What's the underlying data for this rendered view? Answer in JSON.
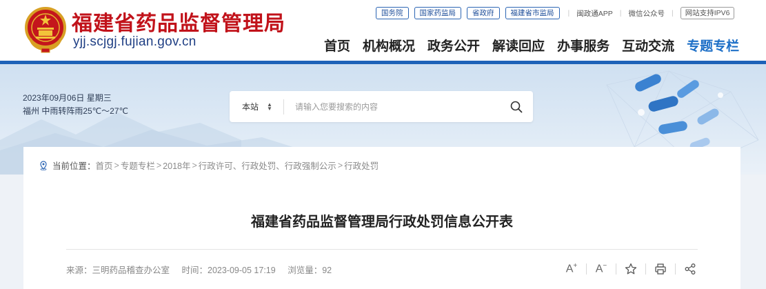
{
  "header": {
    "site_name": "福建省药品监督管理局",
    "site_domain": "yjj.scjgj.fujian.gov.cn",
    "top_links": [
      "国务院",
      "国家药监局",
      "省政府",
      "福建省市监局"
    ],
    "app_link": "闽政通APP",
    "wechat_link": "微信公众号",
    "ipv6_badge": "网站支持IPV6",
    "nav": [
      "首页",
      "机构概况",
      "政务公开",
      "解读回应",
      "办事服务",
      "互动交流",
      "专题专栏"
    ],
    "active_nav": "专题专栏"
  },
  "banner": {
    "date_line": "2023年09月06日 星期三",
    "weather_line": "福州 中雨转阵雨25℃～27℃",
    "search": {
      "scope": "本站",
      "placeholder": "请输入您要搜索的内容"
    }
  },
  "breadcrumb": {
    "label": "当前位置：",
    "items": [
      "首页",
      "专题专栏",
      "2018年",
      "行政许可、行政处罚、行政强制公示",
      "行政处罚"
    ],
    "separator": ">"
  },
  "article": {
    "title": "福建省药品监督管理局行政处罚信息公开表",
    "source": "来源：三明药品稽查办公室",
    "time": "时间：2023-09-05 17:19",
    "views": "浏览量：92"
  },
  "tools": {
    "font_up_icon": "font-increase-icon",
    "font_down_icon": "font-decrease-icon",
    "favorite_icon": "star-icon",
    "print_icon": "print-icon",
    "share_icon": "share-icon"
  },
  "colors": {
    "brand_red": "#c1121a",
    "brand_blue": "#1d62b8",
    "active_nav": "#1d6fc7"
  }
}
